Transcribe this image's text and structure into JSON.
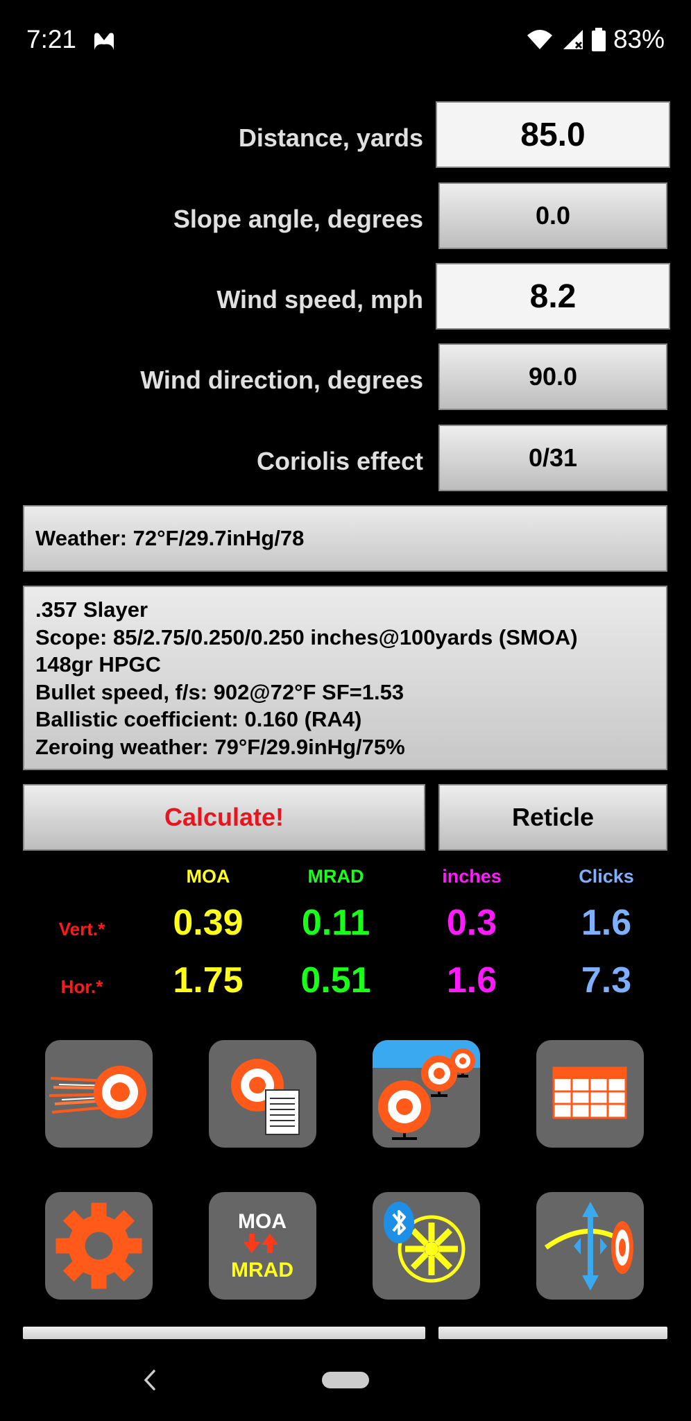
{
  "status": {
    "time": "7:21",
    "battery": "83%"
  },
  "inputs": [
    {
      "label": "Distance, yards",
      "value": "85.0",
      "style": "edit"
    },
    {
      "label": "Slope angle, degrees",
      "value": "0.0",
      "style": "btn"
    },
    {
      "label": "Wind speed, mph",
      "value": "8.2",
      "style": "edit"
    },
    {
      "label": "Wind direction, degrees",
      "value": "90.0",
      "style": "btn"
    },
    {
      "label": "Coriolis effect",
      "value": "0/31",
      "style": "btn"
    }
  ],
  "weather": "Weather: 72°F/29.7inHg/78",
  "profile": {
    "lines": [
      ".357 Slayer",
      "Scope: 85/2.75/0.250/0.250 inches@100yards (SMOA)",
      "148gr HPGC",
      "Bullet speed, f/s: 902@72°F SF=1.53",
      "Ballistic coefficient: 0.160 (RA4)",
      "Zeroing weather: 79°F/29.9inHg/75%"
    ]
  },
  "buttons": {
    "calculate": "Calculate!",
    "reticle": "Reticle"
  },
  "results": {
    "headers": [
      "MOA",
      "MRAD",
      "inches",
      "Clicks"
    ],
    "colors": [
      "#ffff1a",
      "#1aff1a",
      "#ff1aff",
      "#7fb0ff"
    ],
    "vertical_label": "Vert.*",
    "horizontal_label": "Hor.*",
    "vertical": [
      "0.39",
      "0.11",
      "0.3",
      "1.6"
    ],
    "horizontal": [
      "1.75",
      "0.51",
      "1.6",
      "7.3"
    ]
  },
  "tiles": {
    "moa_text": "MOA",
    "mrad_text": "MRAD",
    "icons": [
      "trajectory-icon",
      "target-report-icon",
      "multi-target-icon",
      "table-icon",
      "settings-gear-icon",
      "moa-mrad-convert-icon",
      "bluetooth-kestrel-icon",
      "wind-drift-icon"
    ]
  },
  "accent": "#ff5a1a"
}
